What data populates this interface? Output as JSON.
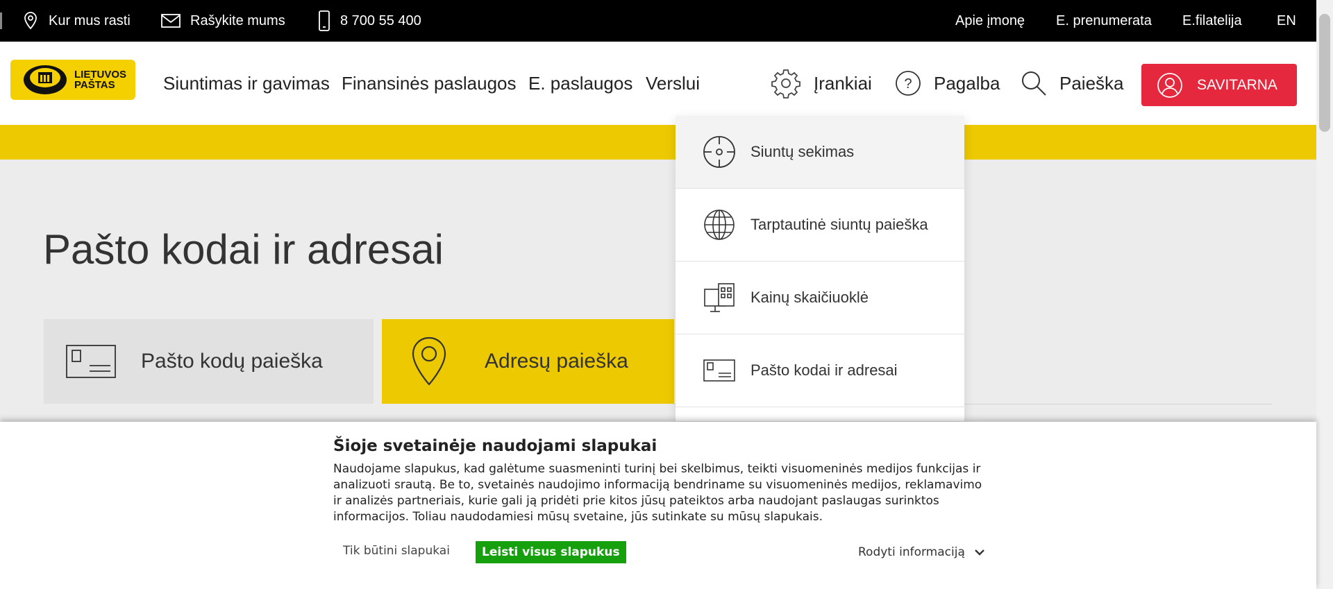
{
  "topbar": {
    "find_us": "Kur mus rasti",
    "write_us": "Rašykite mums",
    "phone": "8 700 55 400",
    "about": "Apie įmonę",
    "subscription": "E. prenumerata",
    "philately": "E.filatelija",
    "language": "EN"
  },
  "logo": {
    "line1": "LIETUVOS",
    "line2": "PAŠTAS"
  },
  "nav": {
    "items": [
      "Siuntimas ir gavimas",
      "Finansinės paslaugos",
      "E. paslaugos",
      "Verslui"
    ],
    "tools": "Įrankiai",
    "help": "Pagalba",
    "search": "Paieška",
    "selfservice": "SAVITARNA"
  },
  "dropdown": {
    "items": [
      "Siuntų sekimas",
      "Tarptautinė siuntų paieška",
      "Kainų skaičiuoklė",
      "Pašto kodai ir adresai"
    ]
  },
  "main": {
    "title": "Pašto kodai ir adresai",
    "tabs": [
      "Pašto kodų paieška",
      "Adresų paieška"
    ]
  },
  "cookie": {
    "title": "Šioje svetainėje naudojami slapukai",
    "text": "Naudojame slapukus, kad galėtume suasmeninti turinį bei skelbimus, teikti visuomeninės medijos funkcijas ir analizuoti srautą. Be to, svetainės naudojimo informaciją bendriname su visuomeninės medijos, reklamavimo ir analizės partneriais, kurie gali ją pridėti prie kitos jūsų pateiktos arba naudojant paslaugas surinktos informacijos. Toliau naudodamiesi mūsų svetaine, jūs sutinkate su mūsų slapukais.",
    "necessary_label": "Tik būtini slapukai",
    "allow_label": "Leisti visus slapukus",
    "show_info_label": "Rodyti informaciją"
  },
  "colors": {
    "brand_yellow": "#ecc900",
    "accent_red": "#e5283d",
    "allow_green": "#17a00e"
  }
}
